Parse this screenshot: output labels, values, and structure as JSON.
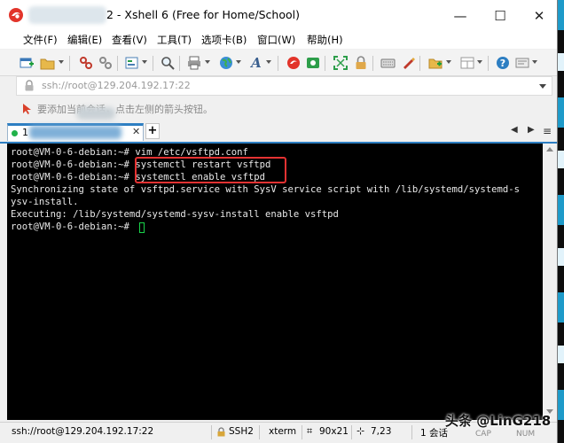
{
  "window": {
    "title": "2 - Xshell 6 (Free for Home/School)",
    "controls": {
      "minimize": "—",
      "maximize": "☐",
      "close": "✕"
    }
  },
  "menu": [
    "文件(F)",
    "编辑(E)",
    "查看(V)",
    "工具(T)",
    "选项卡(B)",
    "窗口(W)",
    "帮助(H)"
  ],
  "toolbar_icons": [
    "new-session-icon",
    "open-folder-icon",
    "reconnect-icon",
    "disconnect-icon",
    "properties-icon",
    "find-icon",
    "print-icon",
    "globe-icon",
    "font-icon",
    "xshell-icon",
    "xftp-icon",
    "fullscreen-icon",
    "lock-icon",
    "keyboard-icon",
    "script-icon",
    "new-tab-icon",
    "layout-icon",
    "help-icon",
    "options-icon"
  ],
  "address": {
    "value": "ssh://root@129.204.192.17:22"
  },
  "hint": {
    "text": "要添加当前会话，点击左侧的箭头按钮。"
  },
  "tabs": [
    {
      "label": "1",
      "close": "✕"
    }
  ],
  "tab_add": "+",
  "terminal": {
    "lines": [
      "root@VM-0-6-debian:~# vim /etc/vsftpd.conf",
      "root@VM-0-6-debian:~# systemctl restart vsftpd",
      "root@VM-0-6-debian:~# systemctl enable vsftpd",
      "Synchronizing state of vsftpd.service with SysV service script with /lib/systemd/systemd-s",
      "ysv-install.",
      "Executing: /lib/systemd/systemd-sysv-install enable vsftpd",
      "root@VM-0-6-debian:~# "
    ]
  },
  "status": {
    "connection": "ssh://root@129.204.192.17:22",
    "protocol": "SSH2",
    "terminal_type": "xterm",
    "size": "90x21",
    "cursor_pos": "7,23",
    "sessions": "1 会话",
    "caps": "CAP",
    "num": "NUM"
  },
  "watermark": "头条 @LinG218",
  "colors": {
    "accent": "#2d7ec2",
    "highlight": "#e53232",
    "cursor": "#19d34a",
    "connected": "#21b24a"
  }
}
